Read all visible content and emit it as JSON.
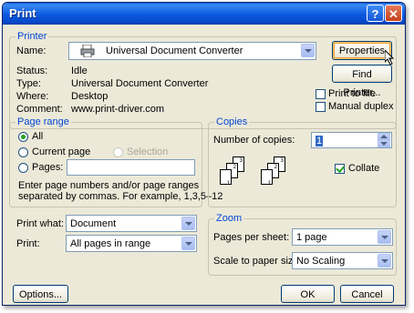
{
  "window": {
    "title": "Print"
  },
  "titlebar": {
    "help_glyph": "?",
    "close_glyph": "✕"
  },
  "printer": {
    "group_label": "Printer",
    "name_label": "Name:",
    "name_value": "Universal Document Converter",
    "status_label": "Status:",
    "status_value": "Idle",
    "type_label": "Type:",
    "type_value": "Universal Document Converter",
    "where_label": "Where:",
    "where_value": "Desktop",
    "comment_label": "Comment:",
    "comment_value": "www.print-driver.com",
    "properties_label": "Properties",
    "find_printer_label": "Find Printer...",
    "print_to_file_label": "Print to file",
    "print_to_file_checked": false,
    "manual_duplex_label": "Manual duplex",
    "manual_duplex_checked": false
  },
  "page_range": {
    "group_label": "Page range",
    "all_label": "All",
    "current_page_label": "Current page",
    "selection_label": "Selection",
    "pages_label": "Pages:",
    "pages_value": "",
    "selected": "All",
    "help_text_line1": "Enter page numbers and/or page ranges",
    "help_text_line2": "separated by commas.  For example, 1,3,5–12"
  },
  "copies": {
    "group_label": "Copies",
    "number_label": "Number of copies:",
    "number_value": "1",
    "collate_label": "Collate",
    "collate_checked": true,
    "page_numbers": [
      "3",
      "2",
      "1"
    ]
  },
  "print_what": {
    "label": "Print what:",
    "value": "Document"
  },
  "print": {
    "label": "Print:",
    "value": "All pages in range"
  },
  "zoom": {
    "group_label": "Zoom",
    "pages_per_sheet_label": "Pages per sheet:",
    "pages_per_sheet_value": "1 page",
    "scale_label": "Scale to paper size:",
    "scale_value": "No Scaling"
  },
  "footer": {
    "options_label": "Options...",
    "ok_label": "OK",
    "cancel_label": "Cancel"
  }
}
